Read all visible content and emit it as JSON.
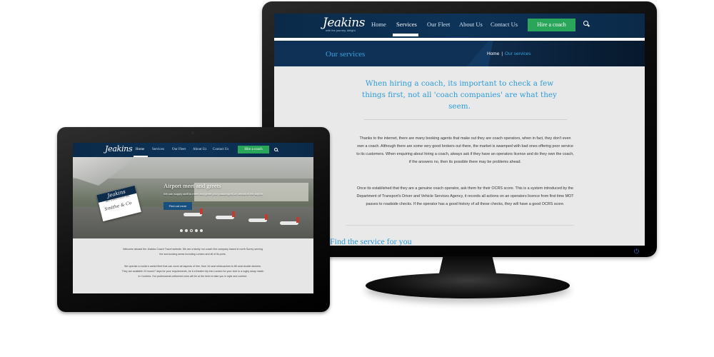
{
  "brand": {
    "logo": "Jeakins",
    "tagline": "with the journey, delight"
  },
  "nav": {
    "items": [
      "Home",
      "Services",
      "Our Fleet",
      "About Us",
      "Contact Us"
    ],
    "active": "Services",
    "hire_label": "Hire a coach"
  },
  "services_page": {
    "banner_title": "Our services",
    "breadcrumb": {
      "home": "Home",
      "sep": "|",
      "current": "Our services"
    },
    "heading": "When hiring a coach, its important to check a few things first, not all 'coach companies' are what they seem.",
    "paragraph1": "Thanks to the internet, there are many booking agents that make out they are coach operators, when in fact, they don't even own a coach.  Although there are some very good brokers out there, the market is swamped with bad ones offering poor service to its customers.  When enquiring about hiring a coach, always ask if they have an operators licence and do they own the coach, if the answers no, then its possible there may be problems ahead.",
    "paragraph2": "Once its established that they are a genuine coach operator, ask them for their OCRS score.  This is a system introduced by the Department of Transport's Driver and Vehicle Services Agency, it records all actions on an operators licence from first time MOT passes to roadside checks.  If the operator has a good history of all these checks, they will have a good OCRS score.",
    "find_heading": "Find the service for you"
  },
  "home_page": {
    "nav_active": "Home",
    "hero_title": "Airport meet and greets",
    "hero_text": "We can supply staff to meet and greet your passengers on arrival at the airport.",
    "hero_button": "Find out more",
    "sign": {
      "head": "Jeakins",
      "sub": "MEET & GREET COACH HIRE",
      "name": "Smithe & Co"
    },
    "slides": 5,
    "active_slide": 2,
    "intro1": "Welcome aboard the Jeakins Coach Travel website. We are a family run coach hire company based in north Surrey serving the surrounding areas including London and all of its ports.",
    "intro2": "We operate a modern varied fleet that can cover all aspects of hire, from 16 seat minicoaches to 86 seat double deckers. They are available 24 hours/7 days for your requirements, be it a theatre trip into London for your club to a rugby away match in Cumbria. Our professional uniformed crew will be at the helm to take you in style and comfort."
  },
  "colors": {
    "navy": "#0b2a49",
    "accent_blue": "#2f9bd7",
    "hire_green": "#2aa65a"
  }
}
